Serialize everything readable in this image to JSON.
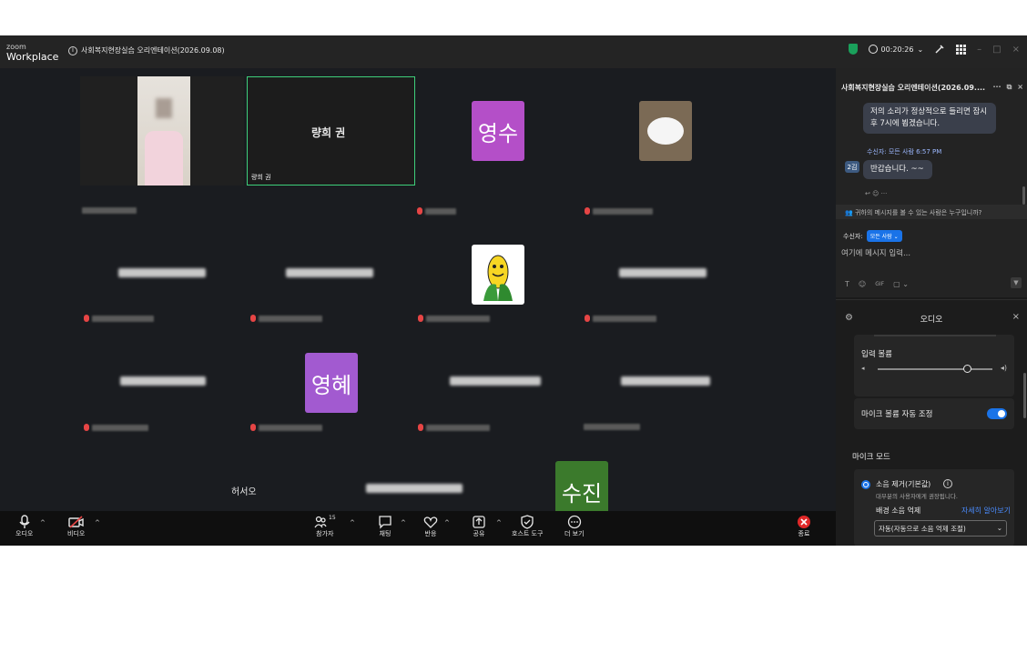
{
  "titlebar": {
    "logo_small": "zoom",
    "logo_big": "Workplace",
    "info_glyph": "i",
    "meeting_title": "사회복지현장실습 오리엔테이션(2026.09.08)",
    "timer": "00:20:26",
    "timer_caret": "⌄",
    "minimize": "–",
    "maximize": "□",
    "close": "×"
  },
  "gallery": {
    "active_name": "량희 권",
    "active_label": "량희 권",
    "avatar_1": "영수",
    "avatar_2": "영혜",
    "avatar_3": "수진",
    "name_hsy": "허서오"
  },
  "toolbar": {
    "audio": "오디오",
    "video": "비디오",
    "participants": "참가자",
    "participants_count": "15",
    "chat": "채팅",
    "reactions": "반응",
    "share": "공유",
    "host_tools": "호스트 도구",
    "more": "더 보기",
    "end": "종료",
    "caret": "^"
  },
  "chat": {
    "header_title": "사회복지현장실습 오리엔테이션(2026.09....",
    "header_more": "···",
    "message_1": "저의 소리가 정상적으로 들리면 잠시 후 7시에 뵙겠습니다.",
    "recipient_line": "수신자: 모든 사람 6:57 PM",
    "sender_initial": "2김",
    "message_2": "반갑습니다. ~~",
    "who_can_see": "귀하의 메시지를 볼 수 있는 사람은 누구입니까?",
    "to_label": "수신자:",
    "to_value": "모든 사람",
    "input_placeholder": "여기에 메시지 입력...",
    "tool_text": "T",
    "tool_emoji": "☺",
    "tool_gif": "GIF",
    "tool_more": "▢ ⌄",
    "send": "▼"
  },
  "audio": {
    "title": "오디오",
    "close": "×",
    "input_volume": "입력 볼륨",
    "input_volume_level": 0.78,
    "auto_adjust": "마이크 볼륨 자동 조정",
    "mic_mode": "마이크 모드",
    "noise_label": "소음 제거(기본값)",
    "noise_desc": "대부분의 사용자에게 권장됩니다.",
    "bg_noise": "배경 소음 억제",
    "learn_more": "자세히 알아보기",
    "bg_select": "자동(자동으로 소음 억제 조절)"
  }
}
